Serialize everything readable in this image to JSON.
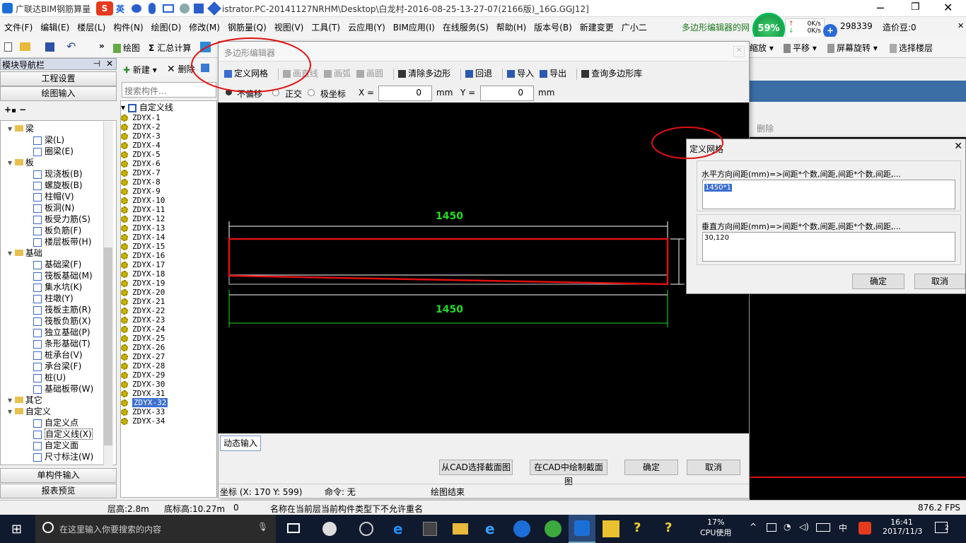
{
  "app": {
    "title_left": "广联达BIM钢筋算量",
    "title_right": "istrator.PC-20141127NRHM\\Desktop\\白龙村-2016-08-25-13-27-07(2166版)_16G.GGJ12]",
    "ime_label": "英"
  },
  "menu": [
    "文件(F)",
    "编辑(E)",
    "楼层(L)",
    "构件(N)",
    "绘图(D)",
    "修改(M)",
    "钢筋量(Q)",
    "视图(V)",
    "工具(T)",
    "云应用(Y)",
    "BIM应用(I)",
    "在线服务(S)",
    "帮助(H)",
    "版本号(B)",
    "新建变更",
    "广小二"
  ],
  "menu_right": {
    "promo": "多边形编辑器的网",
    "score": "298339",
    "price": "造价豆:0"
  },
  "netwidget": {
    "percent": "59%",
    "up": "0K/s",
    "down": "0K/s"
  },
  "toolbar": {
    "draw": "绘图",
    "sum": "汇总计算",
    "zoom": "缩放",
    "pan": "平移",
    "rotate": "屏幕旋转",
    "select_floor": "选择楼层"
  },
  "nav": {
    "title": "模块导航栏",
    "project_settings": "工程设置",
    "drawing_input": "绘图输入",
    "single_input": "单构件输入",
    "report_preview": "报表预览",
    "tree": [
      {
        "label": "梁",
        "level": 0
      },
      {
        "label": "梁(L)",
        "level": 1
      },
      {
        "label": "圈梁(E)",
        "level": 1
      },
      {
        "label": "板",
        "level": 0
      },
      {
        "label": "现浇板(B)",
        "level": 1
      },
      {
        "label": "螺旋板(B)",
        "level": 1
      },
      {
        "label": "柱帽(V)",
        "level": 1
      },
      {
        "label": "板洞(N)",
        "level": 1
      },
      {
        "label": "板受力筋(S)",
        "level": 1
      },
      {
        "label": "板负筋(F)",
        "level": 1
      },
      {
        "label": "楼层板带(H)",
        "level": 1
      },
      {
        "label": "基础",
        "level": 0
      },
      {
        "label": "基础梁(F)",
        "level": 1
      },
      {
        "label": "筏板基础(M)",
        "level": 1
      },
      {
        "label": "集水坑(K)",
        "level": 1
      },
      {
        "label": "柱墩(Y)",
        "level": 1
      },
      {
        "label": "筏板主筋(R)",
        "level": 1
      },
      {
        "label": "筏板负筋(X)",
        "level": 1
      },
      {
        "label": "独立基础(P)",
        "level": 1
      },
      {
        "label": "条形基础(T)",
        "level": 1
      },
      {
        "label": "桩承台(V)",
        "level": 1
      },
      {
        "label": "承台梁(F)",
        "level": 1
      },
      {
        "label": "桩(U)",
        "level": 1
      },
      {
        "label": "基础板带(W)",
        "level": 1
      },
      {
        "label": "其它",
        "level": 0
      },
      {
        "label": "自定义",
        "level": 0
      },
      {
        "label": "自定义点",
        "level": 1
      },
      {
        "label": "自定义线(X)",
        "level": 1
      },
      {
        "label": "自定义面",
        "level": 1
      },
      {
        "label": "尺寸标注(W)",
        "level": 1
      }
    ]
  },
  "components": {
    "new": "新建",
    "delete": "删除",
    "search_placeholder": "搜索构件...",
    "root": "自定义线",
    "items": [
      "ZDYX-1",
      "ZDYX-2",
      "ZDYX-3",
      "ZDYX-4",
      "ZDYX-5",
      "ZDYX-6",
      "ZDYX-7",
      "ZDYX-8",
      "ZDYX-9",
      "ZDYX-10",
      "ZDYX-11",
      "ZDYX-12",
      "ZDYX-13",
      "ZDYX-14",
      "ZDYX-15",
      "ZDYX-16",
      "ZDYX-17",
      "ZDYX-18",
      "ZDYX-19",
      "ZDYX-20",
      "ZDYX-21",
      "ZDYX-22",
      "ZDYX-23",
      "ZDYX-24",
      "ZDYX-25",
      "ZDYX-26",
      "ZDYX-27",
      "ZDYX-28",
      "ZDYX-29",
      "ZDYX-30",
      "ZDYX-31",
      "ZDYX-32",
      "ZDYX-33",
      "ZDYX-34"
    ],
    "selected": "ZDYX-32"
  },
  "editor": {
    "title": "多边形编辑器",
    "tools": [
      "定义网格",
      "画直线",
      "画弧",
      "画圆",
      "清除多边形",
      "回退",
      "导入",
      "导出",
      "查询多边形库"
    ],
    "snap": [
      "不偏移",
      "正交",
      "极坐标"
    ],
    "x_label": "X =",
    "x_value": "0",
    "y_label": "Y =",
    "y_value": "0",
    "unit": "mm",
    "dim_top": "1450",
    "dim_bottom": "1450",
    "dynamic_input": "动态输入",
    "btn_cad_select": "从CAD选择截面图",
    "btn_cad_draw": "在CAD中绘制截面图",
    "ok": "确定",
    "cancel": "取消",
    "status_coord": "坐标 (X: 170 Y: 599)",
    "status_cmd": "命令: 无",
    "status_msg": "绘图结束"
  },
  "bg_toolbar_delete": "删除",
  "grid_dialog": {
    "title": "定义网格",
    "h_label": "水平方向间距(mm)=>间距*个数,间距,间距*个数,间距,...",
    "h_value": "1450*1",
    "v_label": "垂直方向间距(mm)=>间距*个数,间距,间距*个数,间距,...",
    "v_value": "30,120",
    "ok": "确定",
    "cancel": "取消"
  },
  "statusbar": {
    "floor_height": "层高:2.8m",
    "base_height": "底标高:10.27m",
    "zero": "0",
    "msg": "名称在当前层当前构件类型下不允许重名",
    "fps": "876.2 FPS"
  },
  "taskbar": {
    "search": "在这里输入你要搜索的内容",
    "cpu_pct": "17%",
    "cpu_label": "CPU使用",
    "lang": "中",
    "time": "16:41",
    "date": "2017/11/3",
    "notif": "2"
  },
  "colors": {
    "accent_red": "#e01010",
    "dim_green": "#22dd22",
    "select_blue": "#3c6fd0"
  }
}
